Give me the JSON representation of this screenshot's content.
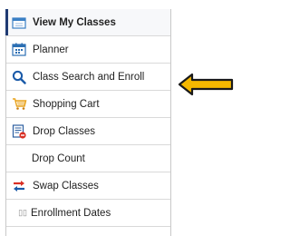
{
  "menu": {
    "items": [
      {
        "label": "View My Classes",
        "icon": "calendar-icon"
      },
      {
        "label": "Planner",
        "icon": "planner-icon"
      },
      {
        "label": "Class Search and Enroll",
        "icon": "search-icon"
      },
      {
        "label": "Shopping Cart",
        "icon": "shopping-cart-icon"
      },
      {
        "label": "Drop Classes",
        "icon": "drop-classes-icon"
      },
      {
        "label": "Drop Count",
        "icon": ""
      },
      {
        "label": "Swap Classes",
        "icon": "swap-icon"
      },
      {
        "label": "Enrollment Dates",
        "icon": "enrollment-dates-icon"
      }
    ],
    "selected_index": 0
  },
  "annotation": {
    "icon": "left-arrow-icon",
    "color": "#f5b800"
  },
  "colors": {
    "accent": "#1f3b73",
    "search_icon": "#1a5aa8",
    "cart_icon": "#e8a21a"
  }
}
